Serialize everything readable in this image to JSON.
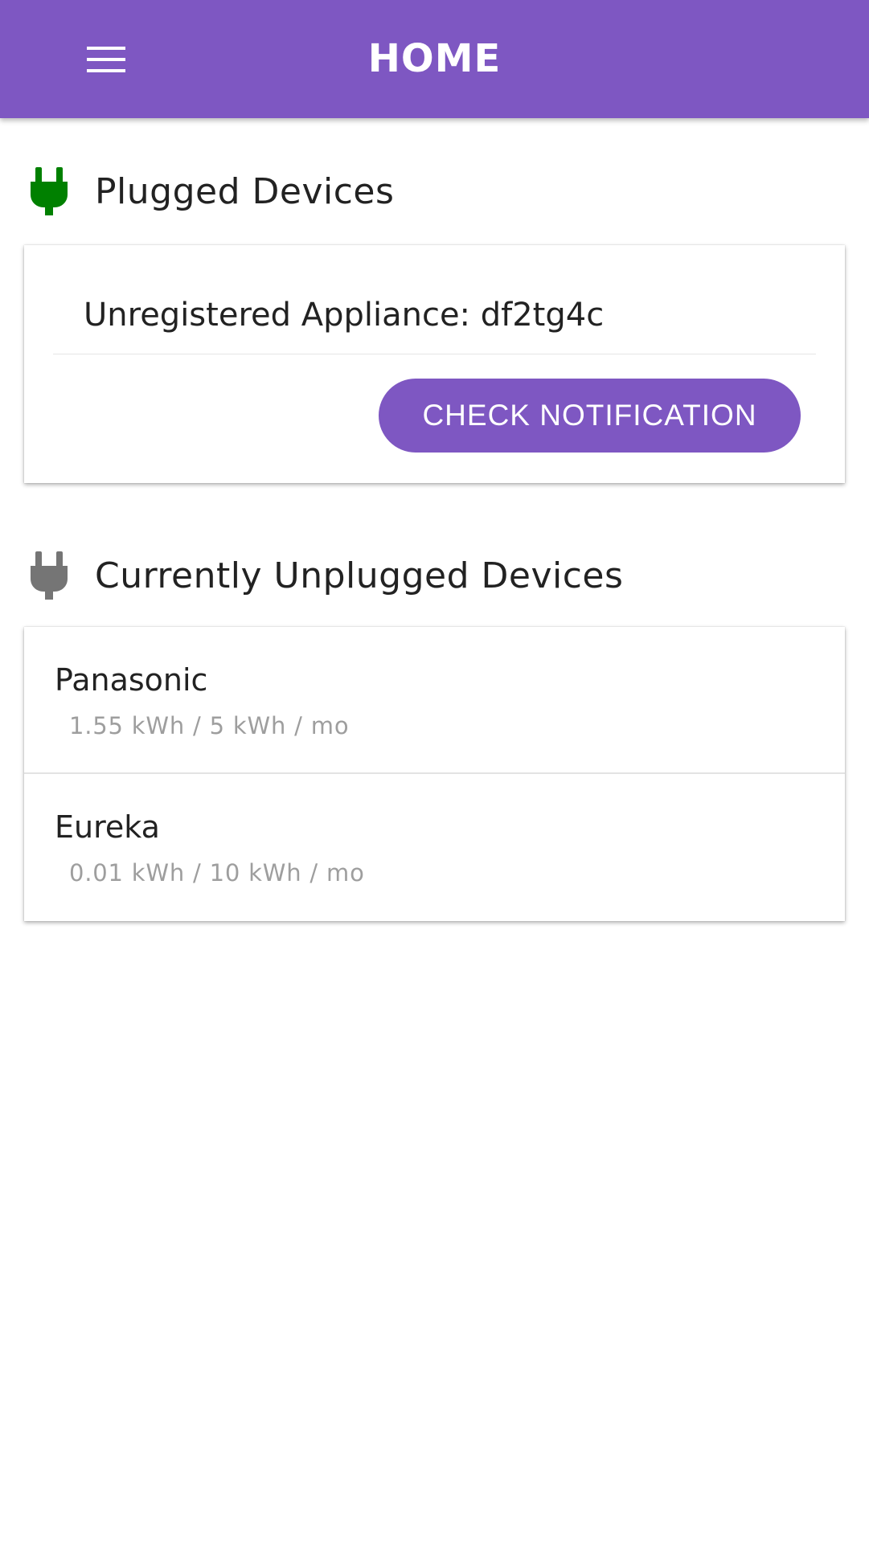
{
  "app_bar": {
    "title": "HOME",
    "menu_icon": "hamburger-menu-icon",
    "background_color": "#7e57c2"
  },
  "plugged_section": {
    "icon": "plug-icon",
    "icon_color": "#008000",
    "title": "Plugged Devices",
    "notice": {
      "text": "Unregistered Appliance: df2tg4c",
      "button_label": "CHECK NOTIFICATION"
    }
  },
  "unplugged_section": {
    "icon": "plug-icon",
    "icon_color": "#757575",
    "title": "Currently Unplugged Devices",
    "devices": [
      {
        "name": "Panasonic",
        "usage": "1.55 kWh / 5 kWh / mo"
      },
      {
        "name": "Eureka",
        "usage": "0.01 kWh / 10 kWh / mo"
      }
    ]
  },
  "colors": {
    "accent": "#7e57c2",
    "plugged": "#008000",
    "unplugged": "#757575",
    "secondary_text": "#9e9e9e"
  }
}
